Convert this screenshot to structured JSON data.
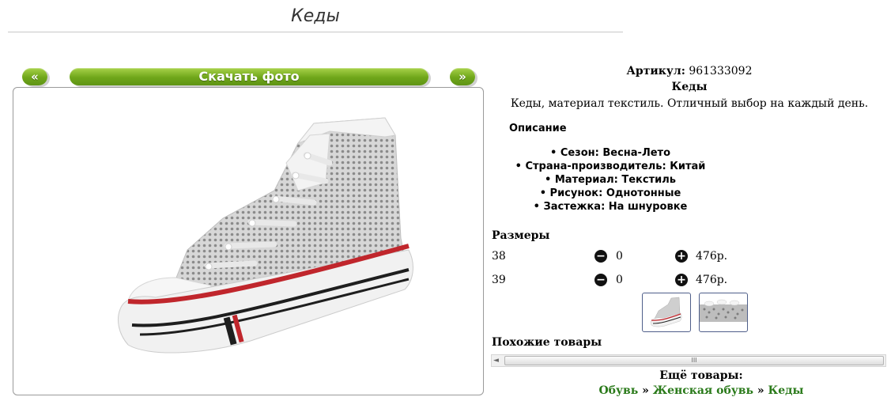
{
  "page": {
    "title": "Кеды"
  },
  "nav": {
    "prev_label": "«",
    "download_label": "Скачать фото",
    "next_label": "»"
  },
  "product": {
    "article_label": "Артикул:",
    "article_value": "961333092",
    "name": "Кеды",
    "short_description": "Кеды, материал текстиль. Отличный выбор на каждый день.",
    "description_heading": "Описание",
    "attributes": [
      "Сезон: Весна-Лето",
      "Страна-производитель: Китай",
      "Материал: Текстиль",
      "Рисунок: Однотонные",
      "Застежка: На шнуровке"
    ]
  },
  "sizes": {
    "heading": "Размеры",
    "rows": [
      {
        "size": "38",
        "qty": "0",
        "price": "476р."
      },
      {
        "size": "39",
        "qty": "0",
        "price": "476р."
      }
    ],
    "minus_glyph": "−",
    "plus_glyph": "+"
  },
  "similar": {
    "heading": "Похожие товары",
    "scroll_left_glyph": "◄",
    "scroll_grip": "III"
  },
  "more": {
    "heading": "Ещё товары:",
    "breadcrumbs": [
      "Обувь",
      "Женская обувь",
      "Кеды"
    ],
    "separator": " » "
  },
  "colors": {
    "accent_green": "#6fa61a",
    "link_green": "#2a7a1a"
  },
  "icons": {
    "remove": "minus-circle-icon",
    "add": "plus-circle-icon"
  }
}
